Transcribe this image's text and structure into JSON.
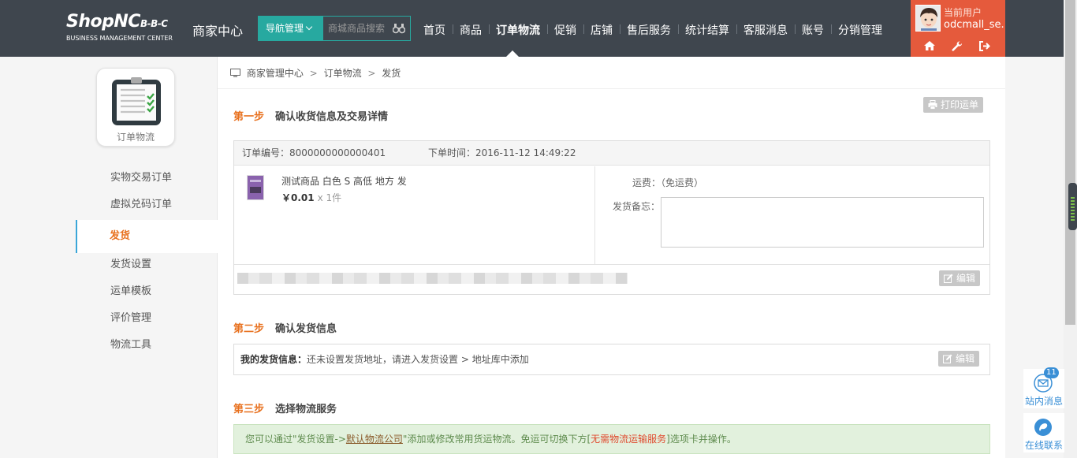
{
  "header": {
    "logo_brand": "ShopNC",
    "logo_suffix": "B-B-C",
    "logo_sub": "BUSINESS MANAGEMENT CENTER",
    "center_title": "商家中心",
    "nav_dropdown_label": "导航管理",
    "search_placeholder": "商城商品搜索",
    "menu": [
      "首页",
      "商品",
      "订单物流",
      "促销",
      "店铺",
      "售后服务",
      "统计结算",
      "客服消息",
      "账号",
      "分销管理"
    ],
    "active_menu": "订单物流",
    "user_label": "当前用户",
    "user_name": "odcmall_se...",
    "accent_color": "#27a9a0",
    "user_box_color": "#e55a3c"
  },
  "sidebar": {
    "app_caption": "订单物流",
    "items": [
      "实物交易订单",
      "虚拟兑码订单",
      "发货",
      "发货设置",
      "运单模板",
      "评价管理",
      "物流工具"
    ],
    "active_item": "发货"
  },
  "breadcrumb": [
    "商家管理中心",
    "订单物流",
    "发货"
  ],
  "step1": {
    "num": "第一步",
    "title": "确认收货信息及交易详情",
    "print_button": "打印运单",
    "order_no_label": "订单编号：8000000000000401",
    "order_time_label": "下单时间：2016-11-12 14:49:22",
    "goods_name": "测试商品 白色 S 高低 地方 发",
    "goods_price": "￥0.01",
    "goods_qty": "x 1件",
    "shipping_fee_label": "运费：（免运费）",
    "note_label": "发货备忘：",
    "edit_button": "编辑"
  },
  "step2": {
    "num": "第二步",
    "title": "确认发货信息",
    "send_info_label": "我的发货信息：",
    "send_info_text": "还未设置发货地址，请进入发货设置 > 地址库中添加",
    "edit_button": "编辑"
  },
  "step3": {
    "num": "第三步",
    "title": "选择物流服务",
    "notice_pre": "您可以通过\"发货设置->",
    "notice_link": "默认物流公司",
    "notice_mid": "\"添加或修改常用货运物流。免运可切换下方[",
    "notice_red": "无需物流运输服务",
    "notice_post": "]选项卡并操作。"
  },
  "floating": {
    "message_label": "站内消息",
    "message_count": "11",
    "contact_label": "在线联系"
  }
}
